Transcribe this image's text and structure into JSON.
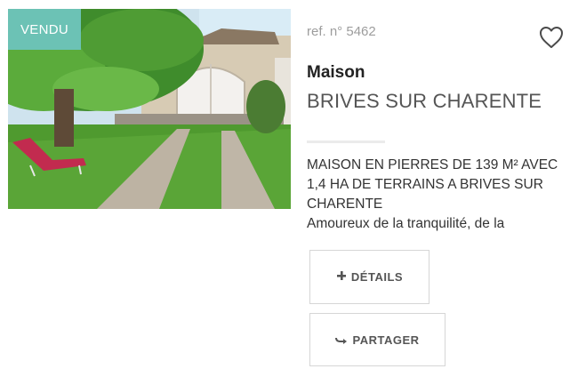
{
  "listing": {
    "status_badge": "VENDU",
    "reference": "ref. n° 5462",
    "property_type": "Maison",
    "city": "BRIVES SUR CHARENTE",
    "headline": "MAISON EN PIERRES DE 139 M² AVEC 1,4 HA DE TERRAINS A BRIVES SUR CHARENTE",
    "description_start": "Amoureux de la tranquilité, de la",
    "badge_color": "#6cc2b5"
  },
  "actions": {
    "details_label": "DÉTAILS",
    "share_label": "PARTAGER",
    "favorite_icon": "heart-icon",
    "details_icon": "plus-icon",
    "share_icon": "arrow-right-icon"
  }
}
